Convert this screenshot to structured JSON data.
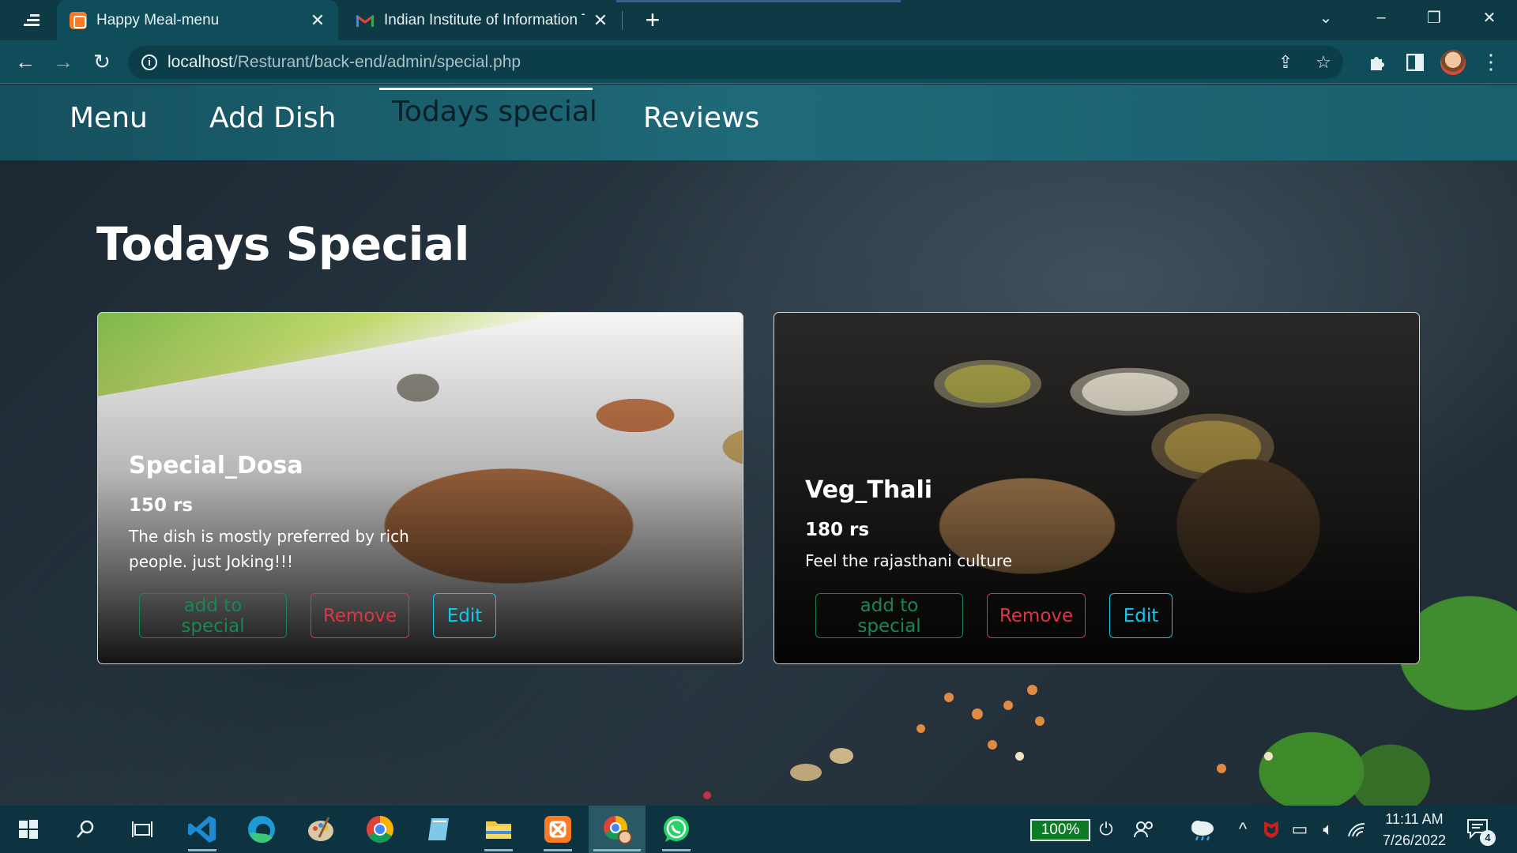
{
  "browser": {
    "tabs": [
      {
        "title": "Happy Meal-menu",
        "active": true
      },
      {
        "title": "Indian Institute of Information Te",
        "active": false
      }
    ],
    "url_host": "localhost",
    "url_path": "/Resturant/back-end/admin/special.php"
  },
  "nav": {
    "items": [
      {
        "label": "Menu"
      },
      {
        "label": "Add Dish"
      },
      {
        "label": "Todays special",
        "active": true
      },
      {
        "label": "Reviews"
      }
    ]
  },
  "page": {
    "heading": "Todays Special"
  },
  "dishes": [
    {
      "name": "Special_Dosa",
      "price": "150 rs",
      "description": "The dish is mostly preferred by rich people. just Joking!!!",
      "buttons": {
        "special": "add to special",
        "remove": "Remove",
        "edit": "Edit"
      }
    },
    {
      "name": "Veg_Thali",
      "price": "180 rs",
      "description": "Feel the rajasthani culture",
      "buttons": {
        "special": "add to special",
        "remove": "Remove",
        "edit": "Edit"
      }
    }
  ],
  "taskbar": {
    "apps": [
      "windows-start",
      "search",
      "task-view",
      "vscode",
      "edge",
      "paint",
      "chrome",
      "notepad",
      "file-explorer",
      "xampp",
      "chrome-profile",
      "whatsapp"
    ],
    "battery": "100%",
    "time": "11:11 AM",
    "date": "7/26/2022",
    "notifications": "4"
  },
  "colors": {
    "nav_bg": "#1f6a79",
    "btn_success": "#198754",
    "btn_danger": "#dc3545",
    "btn_info": "#0dcaf0"
  }
}
